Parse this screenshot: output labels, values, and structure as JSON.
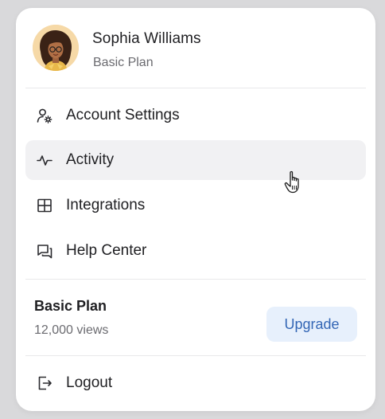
{
  "profile": {
    "name": "Sophia Williams",
    "plan": "Basic Plan"
  },
  "menu": {
    "items": [
      {
        "label": "Account Settings",
        "icon": "user-settings-icon"
      },
      {
        "label": "Activity",
        "icon": "activity-icon"
      },
      {
        "label": "Integrations",
        "icon": "grid-icon"
      },
      {
        "label": "Help Center",
        "icon": "chat-icon"
      }
    ]
  },
  "plan": {
    "title": "Basic Plan",
    "views": "12,000 views",
    "upgrade_label": "Upgrade"
  },
  "logout": {
    "label": "Logout",
    "icon": "logout-icon"
  },
  "colors": {
    "accent": "#3366b5",
    "accent_bg": "#e7f0fc",
    "hover_bg": "#f1f1f3"
  }
}
